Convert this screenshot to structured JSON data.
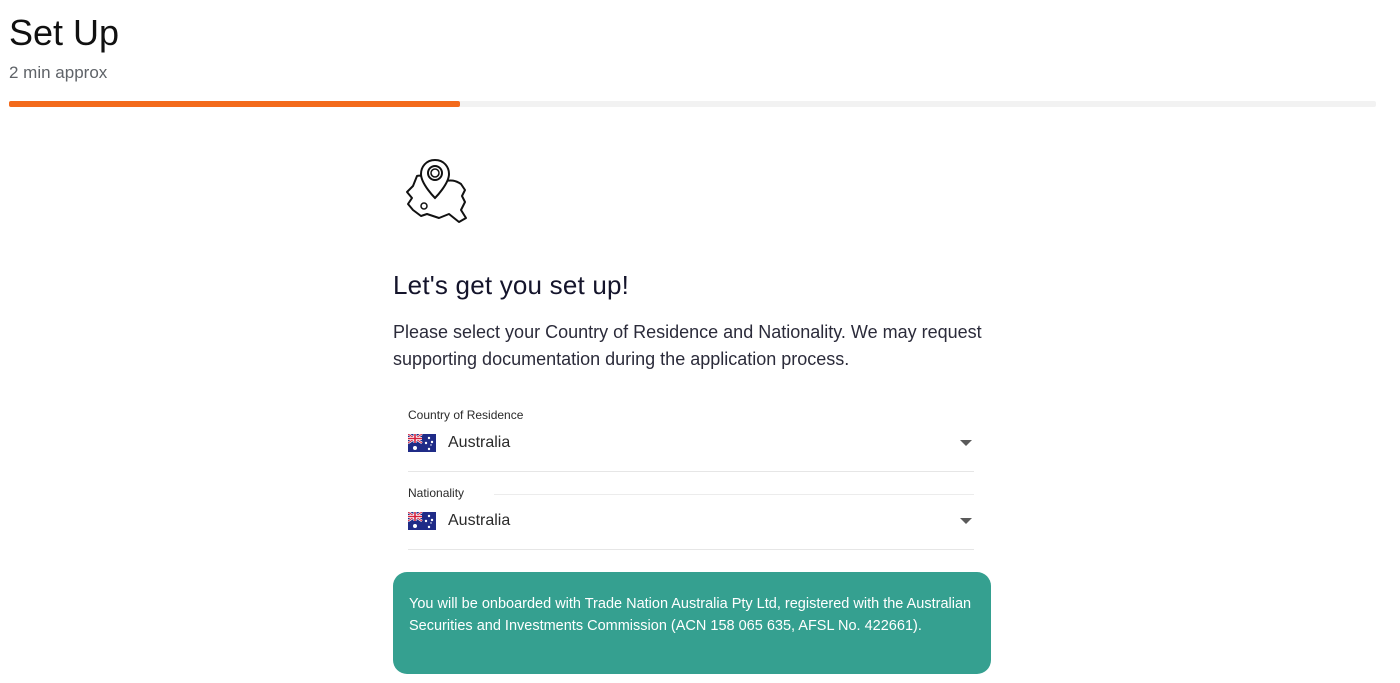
{
  "header": {
    "title": "Set Up",
    "subtitle": "2 min approx",
    "progress_fraction": 0.33
  },
  "colors": {
    "accent": "#f36a1b",
    "notice_bg": "#35a090",
    "progress_track": "#f2f2f2"
  },
  "main": {
    "icon": "map-pin-icon",
    "headline": "Let's get you set up!",
    "description": "Please select your Country of Residence and Nationality. We may request supporting documentation during the application process.",
    "residence": {
      "label": "Country of Residence",
      "value": "Australia",
      "flag_icon": "australia-flag-icon"
    },
    "nationality": {
      "label": "Nationality",
      "value": "Australia",
      "flag_icon": "australia-flag-icon"
    },
    "notice": "You will be onboarded with Trade Nation Australia Pty Ltd, registered with the Australian Securities and Investments Commission (ACN 158 065 635, AFSL No. 422661)."
  }
}
